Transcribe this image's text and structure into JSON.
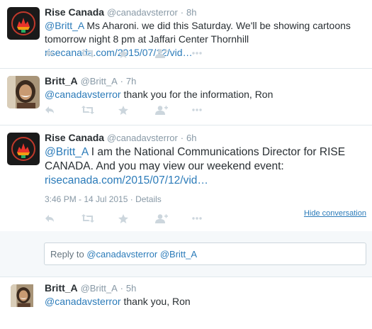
{
  "tweets": [
    {
      "fullname": "Rise Canada",
      "handle": "@canadavsterror",
      "dot": "·",
      "time": "8h",
      "mention": "@Britt_A",
      "text": " Ms Aharoni. we did this Saturday. We'll be showing cartoons tomorrow night 8 pm at Jaffari Center Thornhill ",
      "link": "risecanada.com/2015/07/12/vid…"
    },
    {
      "fullname": "Britt_A",
      "handle": "@Britt_A",
      "dot": "·",
      "time": "7h",
      "mention": "@canadavsterror",
      "text": " thank you for the information, Ron"
    },
    {
      "fullname": "Rise Canada",
      "handle": "@canadavsterror",
      "dot": "·",
      "time": "6h",
      "mention": "@Britt_A",
      "text": " I am the National Communications Director for RISE CANADA. And you may view our weekend event: ",
      "link": "risecanada.com/2015/07/12/vid…",
      "timestamp": "3:46 PM - 14 Jul 2015",
      "details_sep": "·",
      "details": "Details",
      "hide_conversation": "Hide conversation"
    },
    {
      "fullname": "Britt_A",
      "handle": "@Britt_A",
      "dot": "·",
      "time": "5h",
      "mention": "@canadavsterror",
      "text": " thank you, Ron"
    }
  ],
  "reply": {
    "prefix": "Reply to ",
    "mentions": "@canadavsterror @Britt_A"
  },
  "icons": [
    "reply-icon",
    "retweet-icon",
    "favorite-icon",
    "follow-icon",
    "more-icon"
  ],
  "colors": {
    "link": "#2b7bb9",
    "muted": "#8899a6",
    "action_icon": "#ccd6dd",
    "background": "#f5f8fa",
    "rise_logo_bg": "#1a1a1a",
    "rise_logo_accent": "#e8332b"
  }
}
